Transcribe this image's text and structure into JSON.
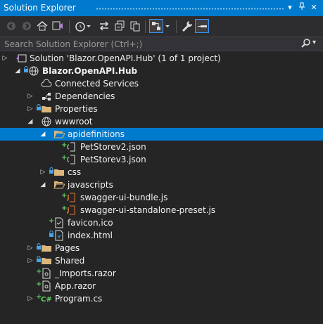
{
  "window": {
    "title": "Solution Explorer"
  },
  "titlebar_buttons": [
    {
      "name": "dropdown-icon",
      "glyph": "▾"
    },
    {
      "name": "pin-icon",
      "glyph": "⌖"
    },
    {
      "name": "close-icon",
      "glyph": "✕"
    }
  ],
  "search": {
    "placeholder": "Search Solution Explorer (Ctrl+;)"
  },
  "colors": {
    "accent": "#007acc",
    "background": "#252526",
    "toolbar": "#2d2d30",
    "folder": "#dcb67a",
    "json": "#cfcfcf",
    "js": "#e37933"
  },
  "tree": [
    {
      "label": "Solution 'Blazor.OpenAPI.Hub' (1 of 1 project)",
      "icon": "solution-icon",
      "expander": "collapsed",
      "badge": ""
    },
    {
      "label": "Blazor.OpenAPI.Hub",
      "icon": "project-icon",
      "expander": "expanded",
      "badge": "lock",
      "bold": true
    },
    {
      "label": "Connected Services",
      "icon": "cloud-icon",
      "expander": "",
      "badge": ""
    },
    {
      "label": "Dependencies",
      "icon": "dependencies-icon",
      "expander": "collapsed",
      "badge": ""
    },
    {
      "label": "Properties",
      "icon": "folder-icon",
      "expander": "collapsed",
      "badge": "lock"
    },
    {
      "label": "wwwroot",
      "icon": "globe-icon",
      "expander": "expanded",
      "badge": ""
    },
    {
      "label": "apidefinitions",
      "icon": "folder-open-icon",
      "expander": "expanded",
      "badge": "",
      "selected": true
    },
    {
      "label": "PetStorev2.json",
      "icon": "json-file-icon",
      "expander": "",
      "badge": "plus"
    },
    {
      "label": "PetStorev3.json",
      "icon": "json-file-icon",
      "expander": "",
      "badge": "plus"
    },
    {
      "label": "css",
      "icon": "folder-icon",
      "expander": "collapsed",
      "badge": "lock"
    },
    {
      "label": "javascripts",
      "icon": "folder-open-icon",
      "expander": "expanded",
      "badge": ""
    },
    {
      "label": "swagger-ui-bundle.js",
      "icon": "js-file-icon",
      "expander": "",
      "badge": "plus"
    },
    {
      "label": "swagger-ui-standalone-preset.js",
      "icon": "js-file-icon",
      "expander": "",
      "badge": "plus"
    },
    {
      "label": "favicon.ico",
      "icon": "ico-file-icon",
      "expander": "",
      "badge": "plus"
    },
    {
      "label": "index.html",
      "icon": "html-file-icon",
      "expander": "",
      "badge": "lock"
    },
    {
      "label": "Pages",
      "icon": "folder-icon",
      "expander": "collapsed",
      "badge": "lock"
    },
    {
      "label": "Shared",
      "icon": "folder-icon",
      "expander": "collapsed",
      "badge": "lock"
    },
    {
      "label": "_Imports.razor",
      "icon": "razor-file-icon",
      "expander": "",
      "badge": "plus"
    },
    {
      "label": "App.razor",
      "icon": "razor-file-icon",
      "expander": "",
      "badge": "plus"
    },
    {
      "label": "Program.cs",
      "icon": "csharp-file-icon",
      "expander": "collapsed",
      "badge": "plus"
    }
  ]
}
